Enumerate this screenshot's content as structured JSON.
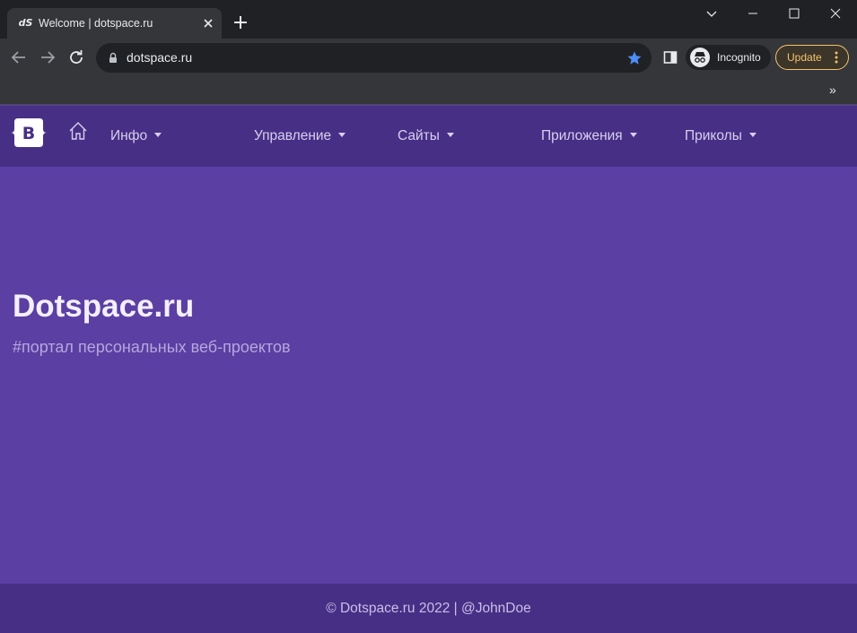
{
  "browser": {
    "tab_title": "Welcome | dotspace.ru",
    "favicon_text": "dS",
    "url": "dotspace.ru",
    "incognito_label": "Incognito",
    "update_label": "Update",
    "bookmarks_more": "»",
    "colors": {
      "tabstrip": "#202124",
      "toolbar": "#35363a",
      "star": "#4c8df6",
      "update": "#f6c26b"
    }
  },
  "navbar": {
    "brand_letter": "B",
    "items": [
      {
        "label": "Инфо"
      },
      {
        "label": "Управление"
      },
      {
        "label": "Сайты"
      },
      {
        "label": "Приложения"
      },
      {
        "label": "Приколы"
      }
    ]
  },
  "hero": {
    "title": "Dotspace.ru",
    "subtitle": "#портал персональных веб-проектов"
  },
  "footer": {
    "text": "© Dotspace.ru 2022 | @JohnDoe"
  },
  "theme": {
    "navbar_bg": "#472f86",
    "hero_bg": "#5b3fa3",
    "footer_bg": "#472f86"
  }
}
